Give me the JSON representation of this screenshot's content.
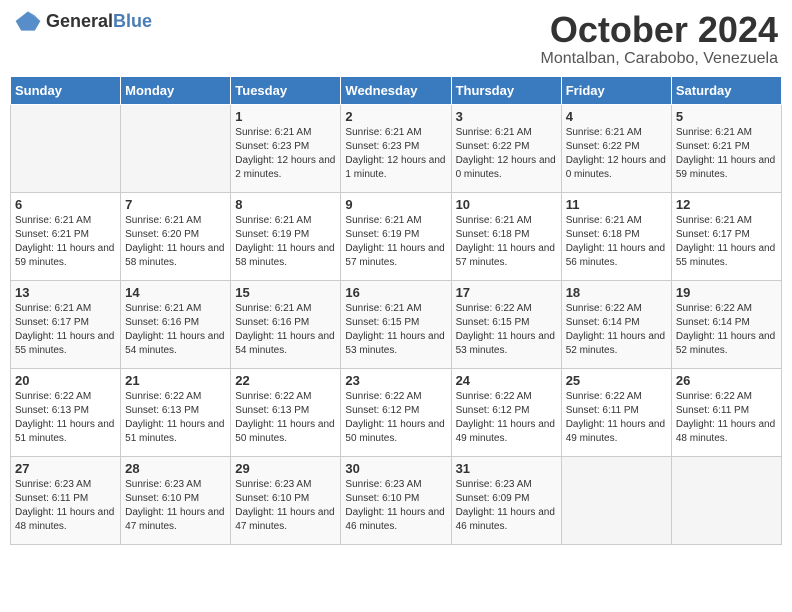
{
  "header": {
    "logo_general": "General",
    "logo_blue": "Blue",
    "month_title": "October 2024",
    "subtitle": "Montalban, Carabobo, Venezuela"
  },
  "weekdays": [
    "Sunday",
    "Monday",
    "Tuesday",
    "Wednesday",
    "Thursday",
    "Friday",
    "Saturday"
  ],
  "weeks": [
    [
      {
        "day": "",
        "info": ""
      },
      {
        "day": "",
        "info": ""
      },
      {
        "day": "1",
        "info": "Sunrise: 6:21 AM\nSunset: 6:23 PM\nDaylight: 12 hours and 2 minutes."
      },
      {
        "day": "2",
        "info": "Sunrise: 6:21 AM\nSunset: 6:23 PM\nDaylight: 12 hours and 1 minute."
      },
      {
        "day": "3",
        "info": "Sunrise: 6:21 AM\nSunset: 6:22 PM\nDaylight: 12 hours and 0 minutes."
      },
      {
        "day": "4",
        "info": "Sunrise: 6:21 AM\nSunset: 6:22 PM\nDaylight: 12 hours and 0 minutes."
      },
      {
        "day": "5",
        "info": "Sunrise: 6:21 AM\nSunset: 6:21 PM\nDaylight: 11 hours and 59 minutes."
      }
    ],
    [
      {
        "day": "6",
        "info": "Sunrise: 6:21 AM\nSunset: 6:21 PM\nDaylight: 11 hours and 59 minutes."
      },
      {
        "day": "7",
        "info": "Sunrise: 6:21 AM\nSunset: 6:20 PM\nDaylight: 11 hours and 58 minutes."
      },
      {
        "day": "8",
        "info": "Sunrise: 6:21 AM\nSunset: 6:19 PM\nDaylight: 11 hours and 58 minutes."
      },
      {
        "day": "9",
        "info": "Sunrise: 6:21 AM\nSunset: 6:19 PM\nDaylight: 11 hours and 57 minutes."
      },
      {
        "day": "10",
        "info": "Sunrise: 6:21 AM\nSunset: 6:18 PM\nDaylight: 11 hours and 57 minutes."
      },
      {
        "day": "11",
        "info": "Sunrise: 6:21 AM\nSunset: 6:18 PM\nDaylight: 11 hours and 56 minutes."
      },
      {
        "day": "12",
        "info": "Sunrise: 6:21 AM\nSunset: 6:17 PM\nDaylight: 11 hours and 55 minutes."
      }
    ],
    [
      {
        "day": "13",
        "info": "Sunrise: 6:21 AM\nSunset: 6:17 PM\nDaylight: 11 hours and 55 minutes."
      },
      {
        "day": "14",
        "info": "Sunrise: 6:21 AM\nSunset: 6:16 PM\nDaylight: 11 hours and 54 minutes."
      },
      {
        "day": "15",
        "info": "Sunrise: 6:21 AM\nSunset: 6:16 PM\nDaylight: 11 hours and 54 minutes."
      },
      {
        "day": "16",
        "info": "Sunrise: 6:21 AM\nSunset: 6:15 PM\nDaylight: 11 hours and 53 minutes."
      },
      {
        "day": "17",
        "info": "Sunrise: 6:22 AM\nSunset: 6:15 PM\nDaylight: 11 hours and 53 minutes."
      },
      {
        "day": "18",
        "info": "Sunrise: 6:22 AM\nSunset: 6:14 PM\nDaylight: 11 hours and 52 minutes."
      },
      {
        "day": "19",
        "info": "Sunrise: 6:22 AM\nSunset: 6:14 PM\nDaylight: 11 hours and 52 minutes."
      }
    ],
    [
      {
        "day": "20",
        "info": "Sunrise: 6:22 AM\nSunset: 6:13 PM\nDaylight: 11 hours and 51 minutes."
      },
      {
        "day": "21",
        "info": "Sunrise: 6:22 AM\nSunset: 6:13 PM\nDaylight: 11 hours and 51 minutes."
      },
      {
        "day": "22",
        "info": "Sunrise: 6:22 AM\nSunset: 6:13 PM\nDaylight: 11 hours and 50 minutes."
      },
      {
        "day": "23",
        "info": "Sunrise: 6:22 AM\nSunset: 6:12 PM\nDaylight: 11 hours and 50 minutes."
      },
      {
        "day": "24",
        "info": "Sunrise: 6:22 AM\nSunset: 6:12 PM\nDaylight: 11 hours and 49 minutes."
      },
      {
        "day": "25",
        "info": "Sunrise: 6:22 AM\nSunset: 6:11 PM\nDaylight: 11 hours and 49 minutes."
      },
      {
        "day": "26",
        "info": "Sunrise: 6:22 AM\nSunset: 6:11 PM\nDaylight: 11 hours and 48 minutes."
      }
    ],
    [
      {
        "day": "27",
        "info": "Sunrise: 6:23 AM\nSunset: 6:11 PM\nDaylight: 11 hours and 48 minutes."
      },
      {
        "day": "28",
        "info": "Sunrise: 6:23 AM\nSunset: 6:10 PM\nDaylight: 11 hours and 47 minutes."
      },
      {
        "day": "29",
        "info": "Sunrise: 6:23 AM\nSunset: 6:10 PM\nDaylight: 11 hours and 47 minutes."
      },
      {
        "day": "30",
        "info": "Sunrise: 6:23 AM\nSunset: 6:10 PM\nDaylight: 11 hours and 46 minutes."
      },
      {
        "day": "31",
        "info": "Sunrise: 6:23 AM\nSunset: 6:09 PM\nDaylight: 11 hours and 46 minutes."
      },
      {
        "day": "",
        "info": ""
      },
      {
        "day": "",
        "info": ""
      }
    ]
  ]
}
